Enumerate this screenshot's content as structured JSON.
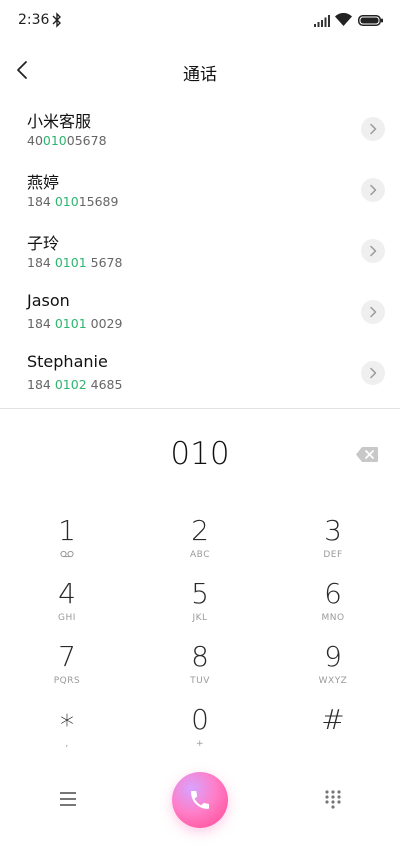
{
  "status_bar": {
    "time": "2:36"
  },
  "header": {
    "title": "通话"
  },
  "contacts": [
    {
      "name": "小米客服",
      "number_pre": "40",
      "number_match": "010",
      "number_post": "05678"
    },
    {
      "name": "燕婷",
      "number_pre": "184 ",
      "number_match": "010",
      "number_post": "15689"
    },
    {
      "name": "子玲",
      "number_pre": "184 ",
      "number_match": "0101",
      "number_post": " 5678"
    },
    {
      "name": "Jason",
      "number_pre": "184 ",
      "number_match": "0101",
      "number_post": " 0029"
    },
    {
      "name": "Stephanie",
      "number_pre": "184 ",
      "number_match": "0102",
      "number_post": " 4685"
    }
  ],
  "dialer": {
    "input_value": "010"
  },
  "keypad": [
    {
      "digit": "1",
      "letters": ""
    },
    {
      "digit": "2",
      "letters": "ABC"
    },
    {
      "digit": "3",
      "letters": "DEF"
    },
    {
      "digit": "4",
      "letters": "GHI"
    },
    {
      "digit": "5",
      "letters": "JKL"
    },
    {
      "digit": "6",
      "letters": "MNO"
    },
    {
      "digit": "7",
      "letters": "PQRS"
    },
    {
      "digit": "8",
      "letters": "TUV"
    },
    {
      "digit": "9",
      "letters": "WXYZ"
    },
    {
      "digit": "∗",
      "letters": ","
    },
    {
      "digit": "0",
      "letters": "+"
    },
    {
      "digit": "#",
      "letters": ""
    }
  ],
  "icons": {
    "back": "back-arrow-icon",
    "detail": "chevron-right-icon",
    "backspace": "backspace-icon",
    "voicemail": "voicemail-icon",
    "menu": "menu-icon",
    "call": "phone-icon",
    "dialpad": "dialpad-icon"
  },
  "colors": {
    "match_highlight": "#2fb46f",
    "call_gradient": [
      "#d7a3ff",
      "#ff7ec8",
      "#b47bff"
    ]
  }
}
